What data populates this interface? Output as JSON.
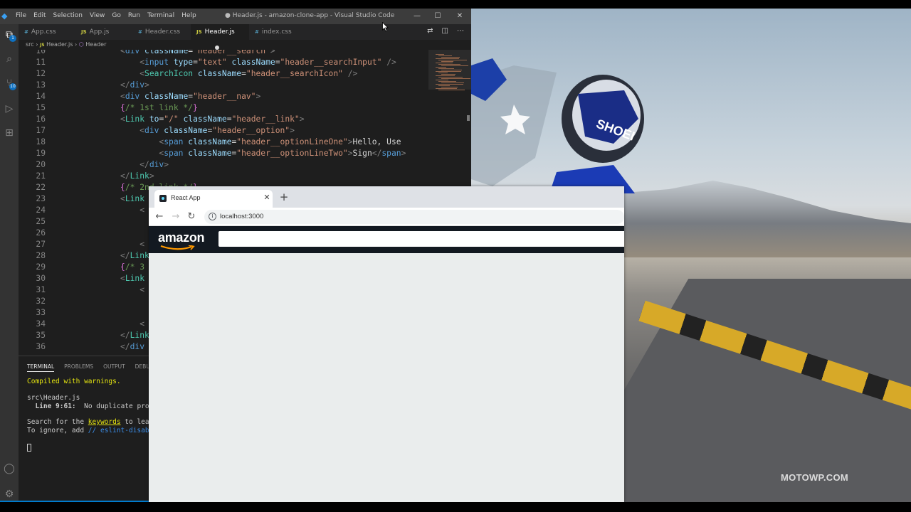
{
  "vscode": {
    "title": "● Header.js - amazon-clone-app - Visual Studio Code",
    "menu": [
      "File",
      "Edit",
      "Selection",
      "View",
      "Go",
      "Run",
      "Terminal",
      "Help"
    ],
    "tabs": [
      {
        "type": "css",
        "icon_text": "#",
        "label": "App.css"
      },
      {
        "type": "js",
        "icon_text": "JS",
        "label": "App.js"
      },
      {
        "type": "css",
        "icon_text": "#",
        "label": "Header.css"
      },
      {
        "type": "js",
        "icon_text": "JS",
        "label": "Header.js",
        "active": true,
        "modified": true
      },
      {
        "type": "css",
        "icon_text": "#",
        "label": "index.css"
      }
    ],
    "breadcrumbs": {
      "folder": "src",
      "file_icon": "JS",
      "file": "Header.js",
      "symbol": "Header"
    },
    "scm_badge": "10",
    "code_lines": [
      {
        "n": "10",
        "html": "<span class=\"t-p\">&lt;</span><span class=\"t-tag\">div</span> <span class=\"t-attr\">className</span>=<span class=\"t-str\">\"header__search\"</span><span class=\"t-p\">&gt;</span>"
      },
      {
        "n": "11",
        "html": "    <span class=\"t-p\">&lt;</span><span class=\"t-tag\">input</span> <span class=\"t-attr\">type</span>=<span class=\"t-str\">\"text\"</span> <span class=\"t-attr\">className</span>=<span class=\"t-str\">\"header__searchInput\"</span> <span class=\"t-p\">/&gt;</span>"
      },
      {
        "n": "12",
        "html": "    <span class=\"t-p\">&lt;</span><span class=\"t-cmp\">SearchIcon</span> <span class=\"t-attr\">className</span>=<span class=\"t-str\">\"header__searchIcon\"</span> <span class=\"t-p\">/&gt;</span>"
      },
      {
        "n": "13",
        "html": "<span class=\"t-p\">&lt;/</span><span class=\"t-tag\">div</span><span class=\"t-p\">&gt;</span>"
      },
      {
        "n": "14",
        "html": "<span class=\"t-p\">&lt;</span><span class=\"t-tag\">div</span> <span class=\"t-attr\">className</span>=<span class=\"t-str\">\"header__nav\"</span><span class=\"t-p\">&gt;</span>"
      },
      {
        "n": "15",
        "html": "<span class=\"t-br\">{</span><span class=\"t-com\">/* 1st link */</span><span class=\"t-br\">}</span>"
      },
      {
        "n": "16",
        "html": "<span class=\"t-p\">&lt;</span><span class=\"t-cmp\">Link</span> <span class=\"t-attr\">to</span>=<span class=\"t-str\">\"/\"</span> <span class=\"t-attr\">className</span>=<span class=\"t-str\">\"header__link\"</span><span class=\"t-p\">&gt;</span>"
      },
      {
        "n": "17",
        "html": "    <span class=\"t-p\">&lt;</span><span class=\"t-tag\">div</span> <span class=\"t-attr\">className</span>=<span class=\"t-str\">\"header__option\"</span><span class=\"t-p\">&gt;</span>"
      },
      {
        "n": "18",
        "html": "        <span class=\"t-p\">&lt;</span><span class=\"t-tag\">span</span> <span class=\"t-attr\">className</span>=<span class=\"t-str\">\"header__optionLineOne\"</span><span class=\"t-p\">&gt;</span>Hello, Use"
      },
      {
        "n": "19",
        "html": "        <span class=\"t-p\">&lt;</span><span class=\"t-tag\">span</span> <span class=\"t-attr\">className</span>=<span class=\"t-str\">\"header__optionLineTwo\"</span><span class=\"t-p\">&gt;</span>Sign<span class=\"t-p\">&lt;/</span><span class=\"t-tag\">span</span><span class=\"t-p\">&gt;</span>"
      },
      {
        "n": "20",
        "html": "    <span class=\"t-p\">&lt;/</span><span class=\"t-tag\">div</span><span class=\"t-p\">&gt;</span>"
      },
      {
        "n": "21",
        "html": "<span class=\"t-p\">&lt;/</span><span class=\"t-cmp\">Link</span><span class=\"t-p\">&gt;</span>"
      },
      {
        "n": "22",
        "html": "<span class=\"t-br\">{</span><span class=\"t-com\">/* 2nd link */</span><span class=\"t-br\">}</span>"
      },
      {
        "n": "23",
        "html": "<span class=\"t-p\">&lt;</span><span class=\"t-cmp\">Link</span>"
      },
      {
        "n": "24",
        "html": "    <span class=\"t-p\">&lt;</span>"
      },
      {
        "n": "25",
        "html": ""
      },
      {
        "n": "26",
        "html": ""
      },
      {
        "n": "27",
        "html": "    <span class=\"t-p\">&lt;</span>"
      },
      {
        "n": "28",
        "html": "<span class=\"t-p\">&lt;/</span><span class=\"t-cmp\">Link</span>"
      },
      {
        "n": "29",
        "html": "<span class=\"t-br\">{</span><span class=\"t-com\">/* 3</span>"
      },
      {
        "n": "30",
        "html": "<span class=\"t-p\">&lt;</span><span class=\"t-cmp\">Link</span>"
      },
      {
        "n": "31",
        "html": "    <span class=\"t-p\">&lt;</span>"
      },
      {
        "n": "32",
        "html": ""
      },
      {
        "n": "33",
        "html": ""
      },
      {
        "n": "34",
        "html": "    <span class=\"t-p\">&lt;</span>"
      },
      {
        "n": "35",
        "html": "<span class=\"t-p\">&lt;/</span><span class=\"t-cmp\">Link</span>"
      },
      {
        "n": "36",
        "html": "<span class=\"t-p\">&lt;/</span><span class=\"t-tag\">div</span>"
      }
    ],
    "panel_tabs": [
      "TERMINAL",
      "PROBLEMS",
      "OUTPUT",
      "DEBUG CO"
    ],
    "terminal": {
      "compiled": "Compiled with warnings.",
      "file": "src\\Header.js",
      "line_loc": "Line 9:61:",
      "line_msg": "  No duplicate props",
      "search_pre": "Search for the ",
      "search_kw": "keywords",
      "search_post": " to learn",
      "ignore_pre": "To ignore, add ",
      "ignore_code": "// eslint-disable"
    }
  },
  "chrome": {
    "tab_title": "React App",
    "url": "localhost:3000"
  },
  "amazon": {
    "logo": "amazon"
  },
  "wallpaper": {
    "brand": "MOTOWP.COM"
  }
}
